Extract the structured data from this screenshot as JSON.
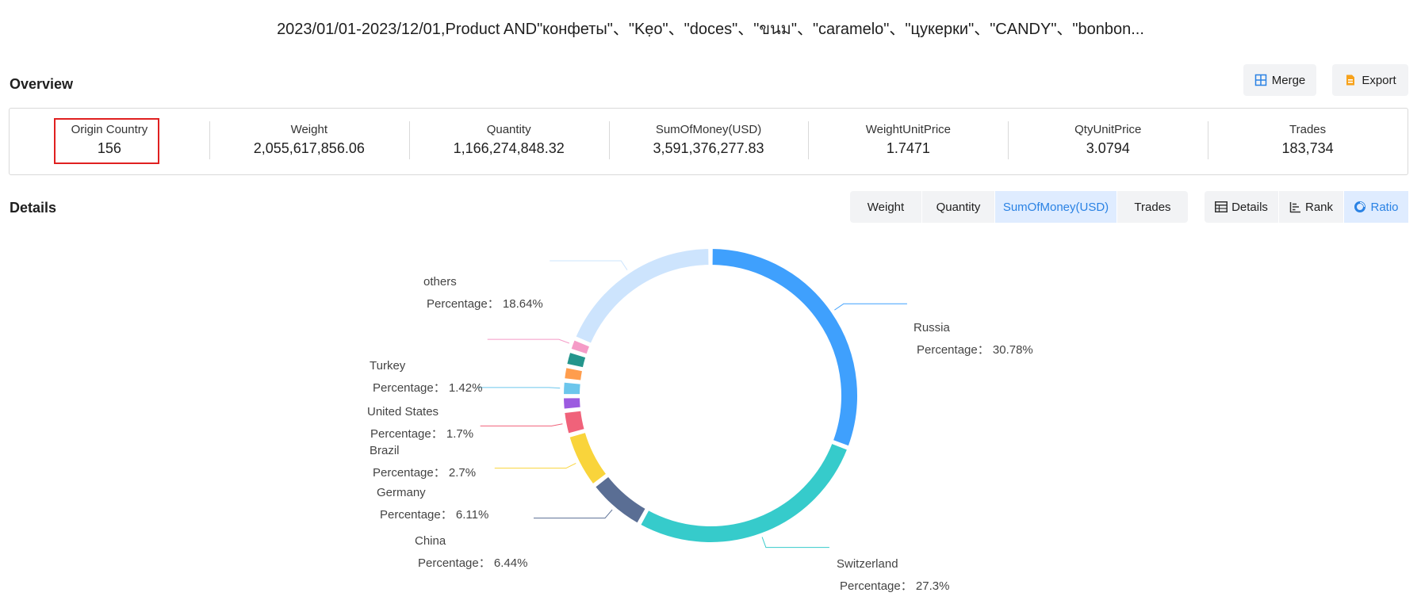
{
  "title": "2023/01/01-2023/12/01,Product AND\"конфеты\"、\"Kẹo\"、\"doces\"、\"ขนม\"、\"caramelo\"、\"цукерки\"、\"CANDY\"、\"bonbon...",
  "overview": {
    "title": "Overview",
    "merge_label": "Merge",
    "export_label": "Export",
    "metrics": [
      {
        "label": "Origin Country",
        "value": "156"
      },
      {
        "label": "Weight",
        "value": "2,055,617,856.06"
      },
      {
        "label": "Quantity",
        "value": "1,166,274,848.32"
      },
      {
        "label": "SumOfMoney(USD)",
        "value": "3,591,376,277.83"
      },
      {
        "label": "WeightUnitPrice",
        "value": "1.7471"
      },
      {
        "label": "QtyUnitPrice",
        "value": "3.0794"
      },
      {
        "label": "Trades",
        "value": "183,734"
      }
    ]
  },
  "details": {
    "title": "Details",
    "metric_tabs": [
      "Weight",
      "Quantity",
      "SumOfMoney(USD)",
      "Trades"
    ],
    "active_metric_tab": "SumOfMoney(USD)",
    "view_tabs": [
      "Details",
      "Rank",
      "Ratio"
    ],
    "active_view_tab": "Ratio"
  },
  "colors": {
    "accent": "#2a82e4",
    "highlight_border": "#e02020"
  },
  "chart_data": {
    "type": "pie",
    "variant": "donut",
    "label_prefix": "Percentage：",
    "slices": [
      {
        "name": "Russia",
        "percent": 30.78,
        "label": "30.78%",
        "color": "#3fa0fd",
        "labeled": true
      },
      {
        "name": "Switzerland",
        "percent": 27.3,
        "label": "27.3%",
        "color": "#36cbcb",
        "labeled": true
      },
      {
        "name": "China",
        "percent": 6.44,
        "label": "6.44%",
        "color": "#5a6e94",
        "labeled": true
      },
      {
        "name": "Germany",
        "percent": 6.11,
        "label": "6.11%",
        "color": "#f9d43b",
        "labeled": true
      },
      {
        "name": "Brazil",
        "percent": 2.7,
        "label": "2.7%",
        "color": "#f0627a",
        "labeled": true
      },
      {
        "name": "",
        "percent": 1.6,
        "label": "",
        "color": "#9c5be0",
        "labeled": false
      },
      {
        "name": "United States",
        "percent": 1.7,
        "label": "1.7%",
        "color": "#6cc6ec",
        "labeled": true
      },
      {
        "name": "",
        "percent": 1.6,
        "label": "",
        "color": "#ff9d4d",
        "labeled": false
      },
      {
        "name": "",
        "percent": 1.7,
        "label": "",
        "color": "#24958c",
        "labeled": false
      },
      {
        "name": "Turkey",
        "percent": 1.42,
        "label": "1.42%",
        "color": "#f59bc7",
        "labeled": true
      },
      {
        "name": "others",
        "percent": 18.64,
        "label": "18.64%",
        "color": "#cde4fd",
        "labeled": true
      }
    ]
  }
}
